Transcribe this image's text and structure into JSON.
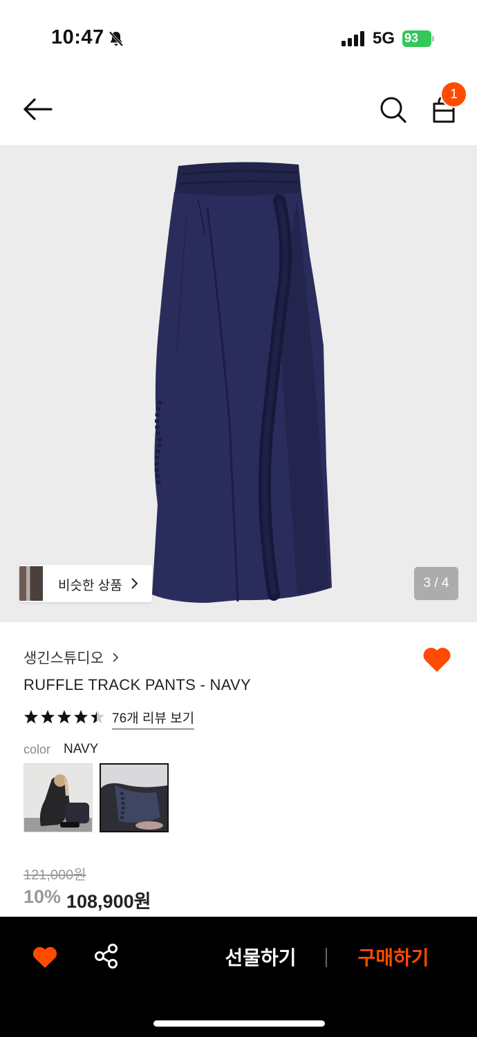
{
  "status_bar": {
    "time": "10:47",
    "network": "5G",
    "battery": "93"
  },
  "header": {
    "cart_count": "1"
  },
  "gallery": {
    "similar_label": "비슷한 상품",
    "counter": "3 / 4"
  },
  "product": {
    "brand": "생긴스튜디오",
    "name": "RUFFLE TRACK PANTS - NAVY",
    "rating": 4.5,
    "review_link": "76개 리뷰 보기",
    "color_label": "color",
    "color_value": "NAVY",
    "original_price": "121,000원",
    "discount": "10%",
    "price": "108,900원"
  },
  "bottom_bar": {
    "gift_label": "선물하기",
    "buy_label": "구매하기"
  },
  "colors": {
    "accent": "#ff4b00",
    "navy": "#24264f",
    "battery": "#34c759"
  }
}
